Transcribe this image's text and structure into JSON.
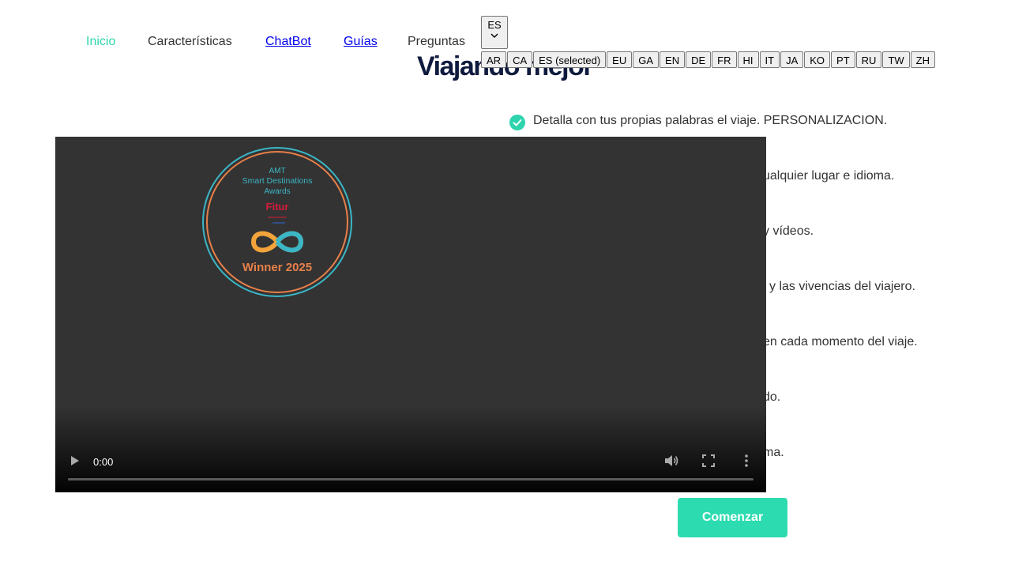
{
  "nav": {
    "items": [
      "Inicio",
      "Características",
      "ChatBot",
      "Guías",
      "Preguntas"
    ]
  },
  "language": {
    "current": "ES",
    "options": [
      "AR",
      "CA",
      "ES (selected)",
      "EU",
      "GA",
      "EN",
      "DE",
      "FR",
      "HI",
      "IT",
      "JA",
      "KO",
      "PT",
      "RU",
      "TW",
      "ZH"
    ]
  },
  "hero": {
    "title": "Viajando mejor"
  },
  "features": [
    "Detalla con tus propias palabras el viaje. PERSONALIZACION.",
    "ualquier lugar e idioma.",
    "y vídeos.",
    "l y las vivencias del viajero.",
    "en cada momento del viaje.",
    "do.",
    "ma."
  ],
  "video": {
    "time": "0:00",
    "badge": {
      "line1": "AMT",
      "line2": "Smart Destinations",
      "line3": "Awards",
      "brand": "Fitur",
      "caption": "Winner 2025"
    },
    "progress": 0
  },
  "cta": {
    "label": "Comenzar"
  },
  "colors": {
    "accent": "#2ddbb0",
    "title": "#0f1a3e",
    "link": "#0000ee",
    "video_bg": "#333333"
  }
}
